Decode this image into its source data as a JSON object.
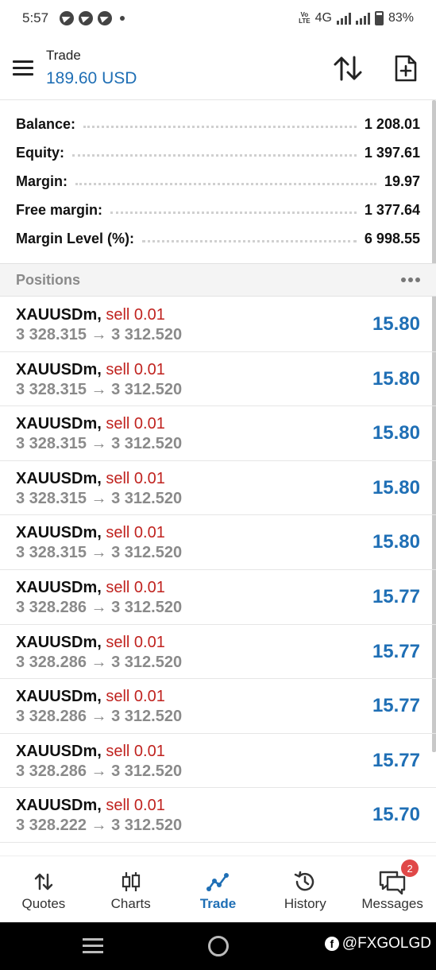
{
  "status": {
    "time": "5:57",
    "network": "4G",
    "battery": "83%"
  },
  "header": {
    "title": "Trade",
    "balance_display": "189.60 USD"
  },
  "summary": {
    "rows": [
      {
        "label": "Balance:",
        "value": "1 208.01"
      },
      {
        "label": "Equity:",
        "value": "1 397.61"
      },
      {
        "label": "Margin:",
        "value": "19.97"
      },
      {
        "label": "Free margin:",
        "value": "1 377.64"
      },
      {
        "label": "Margin Level (%):",
        "value": "6 998.55"
      }
    ]
  },
  "positions": {
    "title": "Positions",
    "items": [
      {
        "symbol": "XAUUSDm,",
        "side": "sell 0.01",
        "prices": "3 328.315 → 3 312.520",
        "profit": "15.80"
      },
      {
        "symbol": "XAUUSDm,",
        "side": "sell 0.01",
        "prices": "3 328.315 → 3 312.520",
        "profit": "15.80"
      },
      {
        "symbol": "XAUUSDm,",
        "side": "sell 0.01",
        "prices": "3 328.315 → 3 312.520",
        "profit": "15.80"
      },
      {
        "symbol": "XAUUSDm,",
        "side": "sell 0.01",
        "prices": "3 328.315 → 3 312.520",
        "profit": "15.80"
      },
      {
        "symbol": "XAUUSDm,",
        "side": "sell 0.01",
        "prices": "3 328.315 → 3 312.520",
        "profit": "15.80"
      },
      {
        "symbol": "XAUUSDm,",
        "side": "sell 0.01",
        "prices": "3 328.286 → 3 312.520",
        "profit": "15.77"
      },
      {
        "symbol": "XAUUSDm,",
        "side": "sell 0.01",
        "prices": "3 328.286 → 3 312.520",
        "profit": "15.77"
      },
      {
        "symbol": "XAUUSDm,",
        "side": "sell 0.01",
        "prices": "3 328.286 → 3 312.520",
        "profit": "15.77"
      },
      {
        "symbol": "XAUUSDm,",
        "side": "sell 0.01",
        "prices": "3 328.286 → 3 312.520",
        "profit": "15.77"
      },
      {
        "symbol": "XAUUSDm,",
        "side": "sell 0.01",
        "prices": "3 328.222 → 3 312.520",
        "profit": "15.70"
      }
    ]
  },
  "nav": {
    "items": [
      {
        "label": "Quotes",
        "icon": "quotes-icon"
      },
      {
        "label": "Charts",
        "icon": "charts-icon"
      },
      {
        "label": "Trade",
        "icon": "trade-icon"
      },
      {
        "label": "History",
        "icon": "history-icon"
      },
      {
        "label": "Messages",
        "icon": "messages-icon",
        "badge": "2"
      }
    ],
    "active": "Trade"
  },
  "watermark": "@FXGOLGD",
  "colors": {
    "accent": "#1f6fb5",
    "sell": "#c0231f",
    "badge": "#e04848"
  }
}
